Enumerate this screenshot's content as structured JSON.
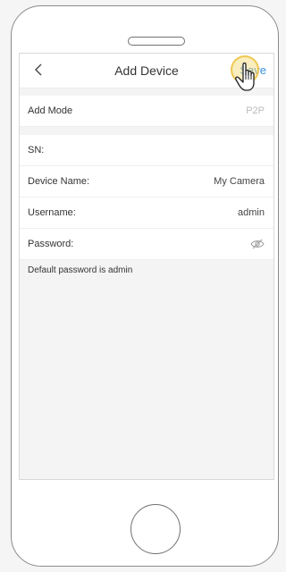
{
  "header": {
    "title": "Add Device",
    "save_label": "Save"
  },
  "form": {
    "add_mode": {
      "label": "Add Mode",
      "value": "P2P"
    },
    "sn": {
      "label": "SN:",
      "value": ""
    },
    "device_name": {
      "label": "Device Name:",
      "value": "My Camera"
    },
    "username": {
      "label": "Username:",
      "value": "admin"
    },
    "password": {
      "label": "Password:",
      "value": ""
    },
    "hint": "Default password is admin"
  },
  "icons": {
    "back": "chevron-left-icon",
    "password_visibility": "eye-off-icon",
    "cursor": "hand-pointer-icon"
  },
  "colors": {
    "accent": "#3a8fe0",
    "highlight": "#f5d66e"
  }
}
